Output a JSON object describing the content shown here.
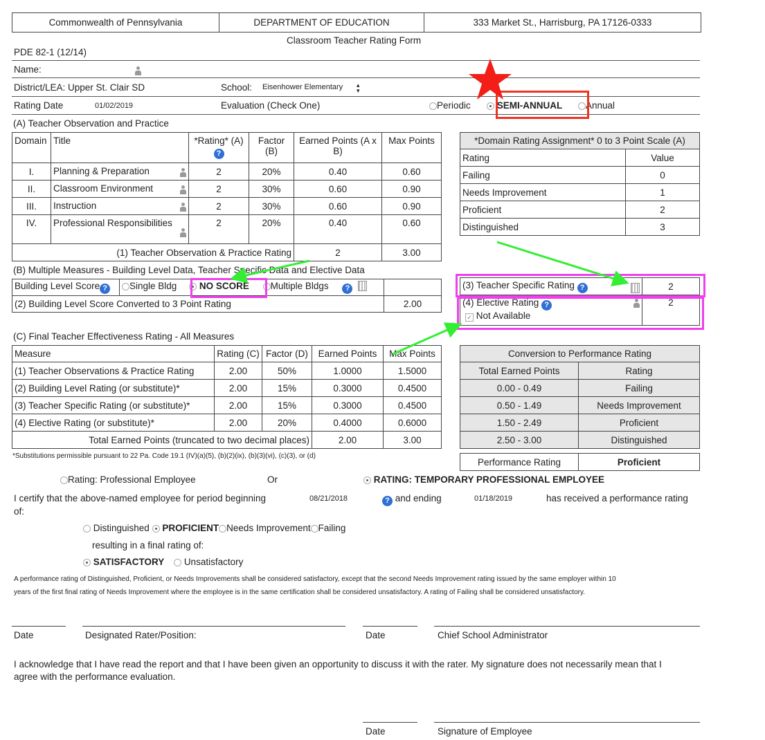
{
  "header": {
    "state": "Commonwealth of Pennsylvania",
    "department": "DEPARTMENT OF EDUCATION",
    "address": "333 Market St., Harrisburg, PA 17126-0333",
    "form_title": "Classroom Teacher Rating Form",
    "form_id": "PDE 82-1 (12/14)"
  },
  "info": {
    "name_label": "Name:",
    "district_label": "District/LEA:",
    "district_value": "Upper St. Clair SD",
    "school_label": "School:",
    "school_value": "Eisenhower Elementary",
    "rating_date_label": "Rating Date",
    "rating_date_value": "01/02/2019",
    "evaluation_label": "Evaluation (Check One)",
    "eval_options": [
      "Periodic",
      "SEMI-ANNUAL",
      "Annual"
    ]
  },
  "sectionA": {
    "title": "(A) Teacher Observation and Practice",
    "headers": [
      "Domain",
      "Title",
      "*Rating* (A)",
      "Factor (B)",
      "Earned Points (A x B)",
      "Max Points"
    ],
    "rows": [
      {
        "domain": "I.",
        "title": "Planning & Preparation",
        "rating": "2",
        "factor": "20%",
        "earned": "0.40",
        "max": "0.60"
      },
      {
        "domain": "II.",
        "title": "Classroom Environment",
        "rating": "2",
        "factor": "30%",
        "earned": "0.60",
        "max": "0.90"
      },
      {
        "domain": "III.",
        "title": "Instruction",
        "rating": "2",
        "factor": "30%",
        "earned": "0.60",
        "max": "0.90"
      },
      {
        "domain": "IV.",
        "title": "Professional Responsibilities",
        "rating": "2",
        "factor": "20%",
        "earned": "0.40",
        "max": "0.60"
      }
    ],
    "total_label": "(1) Teacher Observation & Practice Rating",
    "total_rating": "2",
    "total_max": "3.00"
  },
  "domainScale": {
    "title": "*Domain Rating Assignment* 0 to 3 Point Scale (A)",
    "headers": [
      "Rating",
      "Value"
    ],
    "rows": [
      {
        "rating": "Failing",
        "value": "0"
      },
      {
        "rating": "Needs Improvement",
        "value": "1"
      },
      {
        "rating": "Proficient",
        "value": "2"
      },
      {
        "rating": "Distinguished",
        "value": "3"
      }
    ]
  },
  "sectionB": {
    "title": "(B) Multiple Measures - Building Level Data, Teacher Specific Data and Elective Data",
    "building_label": "Building Level Score",
    "options": [
      "Single Bldg",
      "NO SCORE",
      "Multiple Bldgs"
    ],
    "converted_label": "(2) Building Level Score Converted to 3 Point Rating",
    "converted_value": "2.00",
    "teacher_specific_label": "(3) Teacher Specific Rating",
    "teacher_specific_value": "2",
    "elective_label": "(4) Elective Rating",
    "elective_value": "2",
    "not_available_label": "Not Available",
    "not_available_mark": "✓"
  },
  "sectionC": {
    "title": "(C) Final Teacher Effectiveness Rating - All Measures",
    "headers": [
      "Measure",
      "Rating (C)",
      "Factor (D)",
      "Earned Points",
      "Max Points"
    ],
    "rows": [
      {
        "measure": "(1) Teacher Observations & Practice Rating",
        "rating": "2.00",
        "factor": "50%",
        "earned": "1.0000",
        "max": "1.5000"
      },
      {
        "measure": "(2) Building Level Rating (or substitute)*",
        "rating": "2.00",
        "factor": "15%",
        "earned": "0.3000",
        "max": "0.4500"
      },
      {
        "measure": "(3) Teacher Specific Rating (or substitute)*",
        "rating": "2.00",
        "factor": "15%",
        "earned": "0.3000",
        "max": "0.4500"
      },
      {
        "measure": "(4) Elective Rating (or substitute)*",
        "rating": "2.00",
        "factor": "20%",
        "earned": "0.4000",
        "max": "0.6000"
      }
    ],
    "total_label": "Total Earned Points (truncated to two decimal places)",
    "total_earned": "2.00",
    "total_max": "3.00",
    "footnote": "*Substitutions permissible pursuant to 22 Pa. Code 19.1 (IV)(a)(5), (b)(2)(ix), (b)(3)(vi), (c)(3), or (d)"
  },
  "conversion": {
    "title": "Conversion to Performance Rating",
    "headers": [
      "Total Earned Points",
      "Rating"
    ],
    "rows": [
      {
        "points": "0.00 - 0.49",
        "rating": "Failing"
      },
      {
        "points": "0.50 - 1.49",
        "rating": "Needs Improvement"
      },
      {
        "points": "1.50 - 2.49",
        "rating": "Proficient"
      },
      {
        "points": "2.50 - 3.00",
        "rating": "Distinguished"
      }
    ],
    "performance_label": "Performance Rating",
    "performance_value": "Proficient"
  },
  "certification": {
    "employee_option_1": "Rating: Professional Employee",
    "or_text": "Or",
    "employee_option_2": "RATING: TEMPORARY PROFESSIONAL EMPLOYEE",
    "certify_text_1": "I certify that the above-named employee for period beginning",
    "begin_date": "08/21/2018",
    "and_ending": "and ending",
    "end_date": "01/18/2019",
    "certify_text_2": "has received a performance rating",
    "of_text": "of:",
    "rating_options": [
      "Distinguished",
      "PROFICIENT",
      "Needs Improvement",
      "Failing"
    ],
    "resulting_text": "resulting in a final rating of:",
    "final_options": [
      "SATISFACTORY",
      "Unsatisfactory"
    ],
    "disclaimer_1": "A performance rating of Distinguished, Proficient, or Needs Improvements shall be considered satisfactory, except that the second Needs Improvement rating issued by the same employer within 10",
    "disclaimer_2": "years of the first final rating of Needs Improvement where the employee is in the same certification shall be considered unsatisfactory. A rating of Failing shall be considered unsatisfactory."
  },
  "signatures": {
    "date_label": "Date",
    "rater_label": "Designated Rater/Position:",
    "admin_label": "Chief School Administrator",
    "acknowledge_1": "I acknowledge that I have read the report and that I have been given an opportunity to discuss it with the rater. My signature does not necessarily mean that I",
    "acknowledge_2": "agree with the performance evaluation.",
    "employee_label": "Signature of Employee"
  },
  "icons": {
    "help": "?",
    "annotation_colors": {
      "pink": "#ef3fee",
      "red": "#ee3322",
      "green": "#33ee33"
    }
  }
}
